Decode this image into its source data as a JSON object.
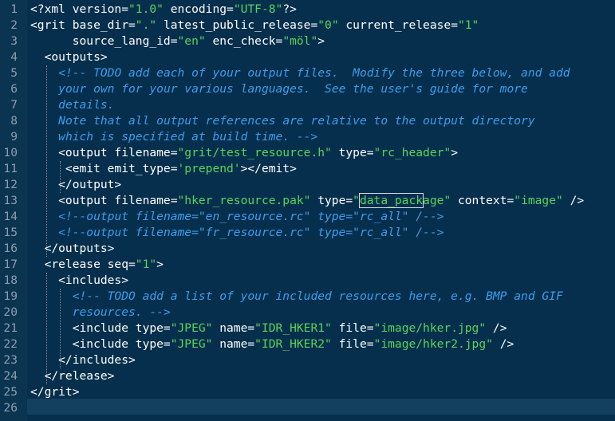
{
  "editor": {
    "lines": [
      {
        "n": "1",
        "segs": [
          [
            "t",
            "<?xml version="
          ],
          [
            "s",
            "\"1.0\""
          ],
          [
            "t",
            " encoding="
          ],
          [
            "s",
            "\"UTF-8\""
          ],
          [
            "t",
            "?>"
          ]
        ]
      },
      {
        "n": "2",
        "segs": [
          [
            "t",
            "<grit base_dir="
          ],
          [
            "s",
            "\".\""
          ],
          [
            "t",
            " latest_public_release="
          ],
          [
            "s",
            "\"0\""
          ],
          [
            "t",
            " current_release="
          ],
          [
            "s",
            "\"1\""
          ]
        ]
      },
      {
        "n": "3",
        "segs": [
          [
            "t",
            "      source_lang_id="
          ],
          [
            "s",
            "\"en\""
          ],
          [
            "t",
            " enc_check="
          ],
          [
            "s",
            "\"möl\""
          ],
          [
            "t",
            ">"
          ]
        ]
      },
      {
        "n": "4",
        "segs": [
          [
            "t",
            "  <outputs>"
          ]
        ]
      },
      {
        "n": "5",
        "segs": [
          [
            "t",
            "    "
          ],
          [
            "c",
            "<!-- TODO add each of your output files.  Modify the three below, and add"
          ]
        ]
      },
      {
        "n": "6",
        "segs": [
          [
            "t",
            "    "
          ],
          [
            "c",
            "your own for your various languages.  See the user's guide for more"
          ]
        ]
      },
      {
        "n": "7",
        "segs": [
          [
            "t",
            "    "
          ],
          [
            "c",
            "details."
          ]
        ]
      },
      {
        "n": "8",
        "segs": [
          [
            "t",
            "    "
          ],
          [
            "c",
            "Note that all output references are relative to the output directory"
          ]
        ]
      },
      {
        "n": "9",
        "segs": [
          [
            "t",
            "    "
          ],
          [
            "c",
            "which is specified at build time. -->"
          ]
        ]
      },
      {
        "n": "10",
        "segs": [
          [
            "t",
            "    <output filename="
          ],
          [
            "s",
            "\"grit/test_resource.h\""
          ],
          [
            "t",
            " type="
          ],
          [
            "s",
            "\"rc_header\""
          ],
          [
            "t",
            ">"
          ]
        ]
      },
      {
        "n": "11",
        "segs": [
          [
            "t",
            "     <emit emit_type="
          ],
          [
            "s",
            "'prepend'"
          ],
          [
            "t",
            "></emit>"
          ]
        ]
      },
      {
        "n": "12",
        "segs": [
          [
            "t",
            "    </output>"
          ]
        ]
      },
      {
        "n": "13",
        "segs": [
          [
            "t",
            "    <output filename="
          ],
          [
            "s",
            "\"hker_resource.pak\""
          ],
          [
            "t",
            " type="
          ],
          [
            "s",
            "\""
          ],
          [
            "sh",
            "data_pack"
          ],
          [
            "s",
            "age\""
          ],
          [
            "t",
            " context="
          ],
          [
            "s",
            "\"image\""
          ],
          [
            "t",
            " />"
          ]
        ]
      },
      {
        "n": "14",
        "segs": [
          [
            "t",
            "    "
          ],
          [
            "c",
            "<!--output filename=\"en_resource.rc\" type=\"rc_all\" /-->"
          ]
        ]
      },
      {
        "n": "15",
        "segs": [
          [
            "t",
            "    "
          ],
          [
            "c",
            "<!--output filename=\"fr_resource.rc\" type=\"rc_all\" /-->"
          ]
        ]
      },
      {
        "n": "16",
        "segs": [
          [
            "t",
            "  </outputs>"
          ]
        ]
      },
      {
        "n": "17",
        "segs": [
          [
            "t",
            "  <release seq="
          ],
          [
            "s",
            "\"1\""
          ],
          [
            "t",
            ">"
          ]
        ]
      },
      {
        "n": "18",
        "segs": [
          [
            "t",
            "    <includes>"
          ]
        ]
      },
      {
        "n": "19",
        "segs": [
          [
            "t",
            "      "
          ],
          [
            "c",
            "<!-- TODO add a list of your included resources here, e.g. BMP and GIF"
          ]
        ]
      },
      {
        "n": "20",
        "segs": [
          [
            "t",
            "      "
          ],
          [
            "c",
            "resources. -->"
          ]
        ]
      },
      {
        "n": "21",
        "segs": [
          [
            "t",
            "      <include type="
          ],
          [
            "s",
            "\"JPEG\""
          ],
          [
            "t",
            " name="
          ],
          [
            "s",
            "\"IDR_HKER1\""
          ],
          [
            "t",
            " file="
          ],
          [
            "s",
            "\"image/hker.jpg\""
          ],
          [
            "t",
            " />"
          ]
        ]
      },
      {
        "n": "22",
        "segs": [
          [
            "t",
            "      <include type="
          ],
          [
            "s",
            "\"JPEG\""
          ],
          [
            "t",
            " name="
          ],
          [
            "s",
            "\"IDR_HKER2\""
          ],
          [
            "t",
            " file="
          ],
          [
            "s",
            "\"image/hker2.jpg\""
          ],
          [
            "t",
            " />"
          ]
        ]
      },
      {
        "n": "23",
        "segs": [
          [
            "t",
            "    </includes>"
          ]
        ]
      },
      {
        "n": "24",
        "segs": [
          [
            "t",
            "  </release>"
          ]
        ]
      },
      {
        "n": "25",
        "segs": [
          [
            "t",
            "</grit>"
          ]
        ]
      },
      {
        "n": "26",
        "segs": [
          [
            "t",
            ""
          ]
        ]
      }
    ],
    "current_line": "26"
  }
}
